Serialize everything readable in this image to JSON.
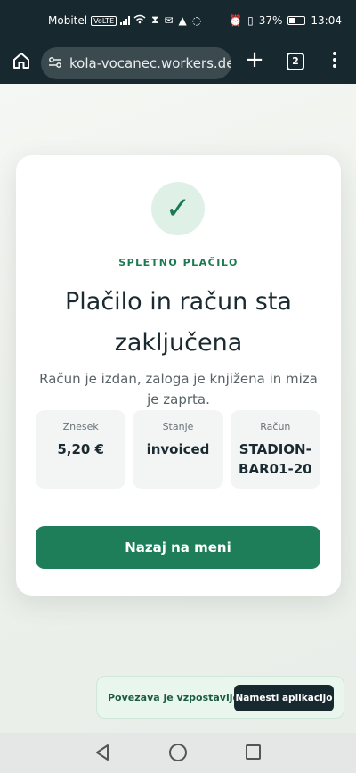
{
  "status_bar": {
    "carrier": "Mobitel",
    "volte": "VoLTE",
    "battery": "37%",
    "time": "13:04"
  },
  "browser": {
    "url": "kola-vocanec.workers.dev",
    "tab_count": "2"
  },
  "card": {
    "eyebrow": "SPLETNO PLAČILO",
    "title": "Plačilo in račun sta zaključena",
    "subtitle": "Račun je izdan, zaloga je knjižena in miza je zaprta.",
    "stats": [
      {
        "label": "Znesek",
        "value": "5,20 €"
      },
      {
        "label": "Stanje",
        "value": "invoiced"
      },
      {
        "label": "Račun",
        "value": "STADION-BAR01-20"
      }
    ],
    "back_button": "Nazaj na meni"
  },
  "toast": {
    "message": "Povezava je vzpostavljena",
    "install_button": "Namesti aplikacijo"
  },
  "colors": {
    "accent": "#1f7e5a",
    "toolbar_bg": "#17282e"
  }
}
